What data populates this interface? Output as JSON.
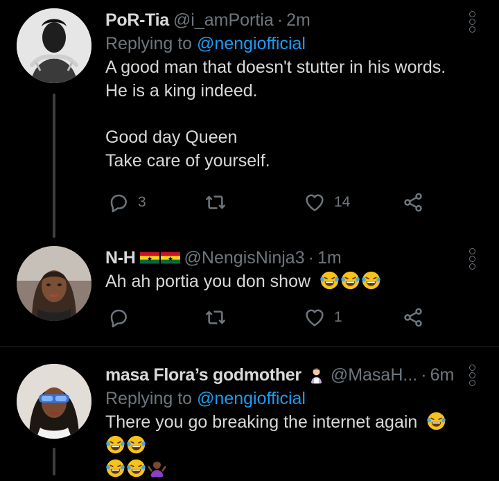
{
  "tweets": [
    {
      "name": "PoR-Tia",
      "handle": "@i_amPortia",
      "time": "2m",
      "replying_prefix": "Replying to ",
      "replying_to": "@nengiofficial",
      "lines": [
        "A good man that doesn't stutter in his words.",
        "He is a king indeed."
      ],
      "lines2": [
        "Good day Queen",
        "Take care of yourself."
      ],
      "replies": "3",
      "retweets": "",
      "likes": "14"
    },
    {
      "name": "N-H",
      "handle": "@NengisNinja3",
      "time": "1m",
      "text": "Ah ah portia you don show",
      "replies": "",
      "retweets": "",
      "likes": "1"
    },
    {
      "name": "masa Flora’s godmother",
      "handle": "@MasaH...",
      "time": "6m",
      "replying_prefix": "Replying to ",
      "replying_to": "@nengiofficial",
      "text": "There you go breaking the internet again"
    }
  ],
  "separator": "·",
  "colors": {
    "background": "#000000",
    "text": "#d9d9d9",
    "muted": "#6e767d",
    "link": "#1d9bf0",
    "divider": "#2f3336"
  },
  "icons": [
    "reply-icon",
    "retweet-icon",
    "like-icon",
    "share-icon",
    "more-icon",
    "ghana-flag-icon",
    "laughing-tears-emoji",
    "person-shrugging-emoji",
    "person-emoji"
  ]
}
